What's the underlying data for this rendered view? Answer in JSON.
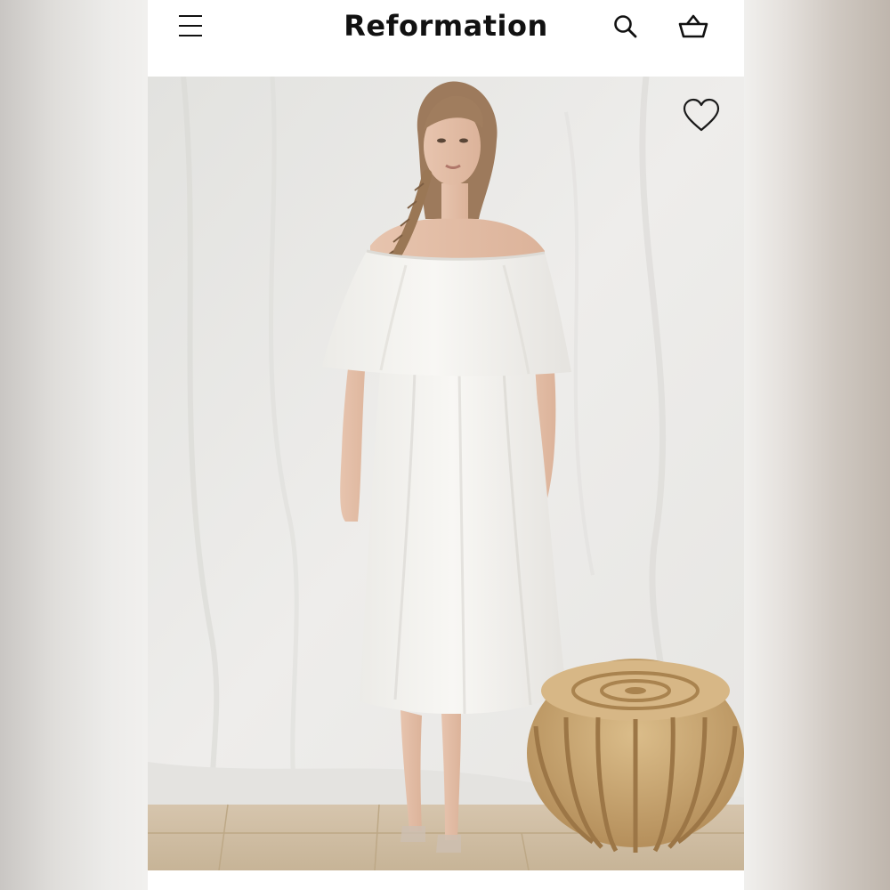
{
  "header": {
    "brand": "Reformation",
    "menu_icon": "hamburger-menu-icon",
    "search_icon": "search-icon",
    "cart_icon": "shopping-basket-icon"
  },
  "product_image": {
    "wishlist_icon": "heart-outline-icon"
  },
  "colors": {
    "header_background": "#ffffff",
    "brand_text": "#111111",
    "dress": "#f6f5f2",
    "backdrop": "#ecebe8",
    "stool": "#c8a572"
  }
}
